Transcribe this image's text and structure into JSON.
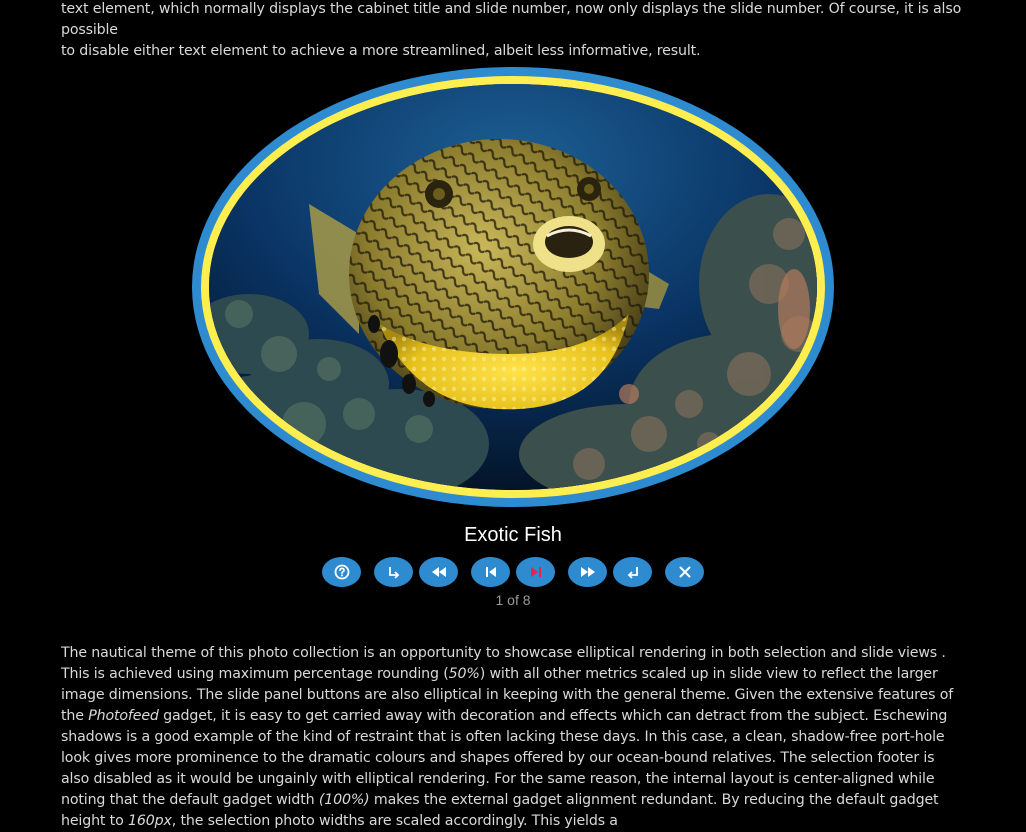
{
  "intro": {
    "line1": "text element, which normally displays the cabinet title and slide number, now only displays the slide number. Of course, it is also possible",
    "line2": "to disable either text element to achieve a more streamlined, albeit less informative, result."
  },
  "slide": {
    "caption": "Exotic Fish",
    "counter": "1 of 8",
    "image_subject": "pufferfish on coral reef"
  },
  "buttons": [
    {
      "name": "help-button",
      "icon": "question-circle-icon"
    },
    {
      "name": "exit-slide-view-button",
      "icon": "arrow-down-right-icon"
    },
    {
      "name": "rewind-button",
      "icon": "rewind-icon"
    },
    {
      "name": "first-slide-button",
      "icon": "skip-back-icon"
    },
    {
      "name": "play-pause-button",
      "icon": "play-pause-icon"
    },
    {
      "name": "fast-forward-button",
      "icon": "fast-forward-icon"
    },
    {
      "name": "return-button",
      "icon": "return-arrow-icon"
    },
    {
      "name": "close-button",
      "icon": "close-icon"
    }
  ],
  "body_text": {
    "s1": "The nautical theme of this photo collection is an opportunity to showcase elliptical rendering in both selection and slide views . This is achieved using maximum percentage rounding (",
    "s1_em": "50%",
    "s2": ")  with all other metrics scaled up in slide view to reflect the larger image dimensions. The slide panel buttons are also elliptical in keeping with the general theme. Given the extensive features of the ",
    "s2_em": "Photofeed",
    "s3": " gadget, it is easy to get carried away with decoration and effects which can detract from the subject. Eschewing shadows is a good example of the kind of restraint that is often lacking these days. In this case, a clean, shadow-free port-hole look gives more prominence to the dramatic colours and shapes offered by our ocean-bound relatives. The selection footer is also disabled as it would be ungainly with elliptical rendering. For the same reason, the internal layout is center-aligned while noting that the default gadget width ",
    "s3_em": "(100%)",
    "s4": " makes the external gadget alignment redundant.  By reducing the default gadget height to ",
    "s4_em": "160px",
    "s5": ", the selection photo widths are scaled accordingly. This yields a"
  },
  "colors": {
    "background": "#000000",
    "frame_outer": "#2f8bd0",
    "frame_inner": "#ffee4f",
    "button": "#2f8bd0",
    "play_icon": "#e8224a"
  }
}
